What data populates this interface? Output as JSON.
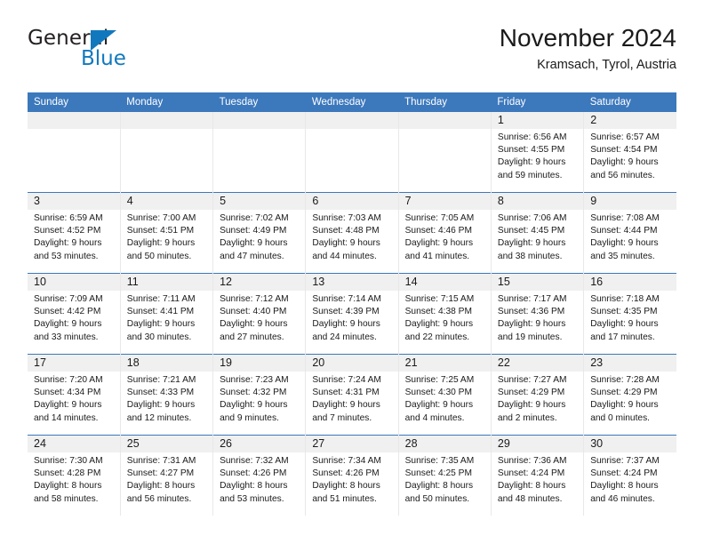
{
  "brand": {
    "name_part1": "General",
    "name_part2": "Blue",
    "triangle_color": "#1278be"
  },
  "header": {
    "title": "November 2024",
    "location": "Kramsach, Tyrol, Austria"
  },
  "theme": {
    "header_blue": "#3c78bc",
    "date_band_gray": "#f0f0f0",
    "text_color": "#1a1a1a"
  },
  "weekday_headers": [
    "Sunday",
    "Monday",
    "Tuesday",
    "Wednesday",
    "Thursday",
    "Friday",
    "Saturday"
  ],
  "weeks": [
    [
      {
        "day": "",
        "details": ""
      },
      {
        "day": "",
        "details": ""
      },
      {
        "day": "",
        "details": ""
      },
      {
        "day": "",
        "details": ""
      },
      {
        "day": "",
        "details": ""
      },
      {
        "day": "1",
        "details": "Sunrise: 6:56 AM\nSunset: 4:55 PM\nDaylight: 9 hours\nand 59 minutes."
      },
      {
        "day": "2",
        "details": "Sunrise: 6:57 AM\nSunset: 4:54 PM\nDaylight: 9 hours\nand 56 minutes."
      }
    ],
    [
      {
        "day": "3",
        "details": "Sunrise: 6:59 AM\nSunset: 4:52 PM\nDaylight: 9 hours\nand 53 minutes."
      },
      {
        "day": "4",
        "details": "Sunrise: 7:00 AM\nSunset: 4:51 PM\nDaylight: 9 hours\nand 50 minutes."
      },
      {
        "day": "5",
        "details": "Sunrise: 7:02 AM\nSunset: 4:49 PM\nDaylight: 9 hours\nand 47 minutes."
      },
      {
        "day": "6",
        "details": "Sunrise: 7:03 AM\nSunset: 4:48 PM\nDaylight: 9 hours\nand 44 minutes."
      },
      {
        "day": "7",
        "details": "Sunrise: 7:05 AM\nSunset: 4:46 PM\nDaylight: 9 hours\nand 41 minutes."
      },
      {
        "day": "8",
        "details": "Sunrise: 7:06 AM\nSunset: 4:45 PM\nDaylight: 9 hours\nand 38 minutes."
      },
      {
        "day": "9",
        "details": "Sunrise: 7:08 AM\nSunset: 4:44 PM\nDaylight: 9 hours\nand 35 minutes."
      }
    ],
    [
      {
        "day": "10",
        "details": "Sunrise: 7:09 AM\nSunset: 4:42 PM\nDaylight: 9 hours\nand 33 minutes."
      },
      {
        "day": "11",
        "details": "Sunrise: 7:11 AM\nSunset: 4:41 PM\nDaylight: 9 hours\nand 30 minutes."
      },
      {
        "day": "12",
        "details": "Sunrise: 7:12 AM\nSunset: 4:40 PM\nDaylight: 9 hours\nand 27 minutes."
      },
      {
        "day": "13",
        "details": "Sunrise: 7:14 AM\nSunset: 4:39 PM\nDaylight: 9 hours\nand 24 minutes."
      },
      {
        "day": "14",
        "details": "Sunrise: 7:15 AM\nSunset: 4:38 PM\nDaylight: 9 hours\nand 22 minutes."
      },
      {
        "day": "15",
        "details": "Sunrise: 7:17 AM\nSunset: 4:36 PM\nDaylight: 9 hours\nand 19 minutes."
      },
      {
        "day": "16",
        "details": "Sunrise: 7:18 AM\nSunset: 4:35 PM\nDaylight: 9 hours\nand 17 minutes."
      }
    ],
    [
      {
        "day": "17",
        "details": "Sunrise: 7:20 AM\nSunset: 4:34 PM\nDaylight: 9 hours\nand 14 minutes."
      },
      {
        "day": "18",
        "details": "Sunrise: 7:21 AM\nSunset: 4:33 PM\nDaylight: 9 hours\nand 12 minutes."
      },
      {
        "day": "19",
        "details": "Sunrise: 7:23 AM\nSunset: 4:32 PM\nDaylight: 9 hours\nand 9 minutes."
      },
      {
        "day": "20",
        "details": "Sunrise: 7:24 AM\nSunset: 4:31 PM\nDaylight: 9 hours\nand 7 minutes."
      },
      {
        "day": "21",
        "details": "Sunrise: 7:25 AM\nSunset: 4:30 PM\nDaylight: 9 hours\nand 4 minutes."
      },
      {
        "day": "22",
        "details": "Sunrise: 7:27 AM\nSunset: 4:29 PM\nDaylight: 9 hours\nand 2 minutes."
      },
      {
        "day": "23",
        "details": "Sunrise: 7:28 AM\nSunset: 4:29 PM\nDaylight: 9 hours\nand 0 minutes."
      }
    ],
    [
      {
        "day": "24",
        "details": "Sunrise: 7:30 AM\nSunset: 4:28 PM\nDaylight: 8 hours\nand 58 minutes."
      },
      {
        "day": "25",
        "details": "Sunrise: 7:31 AM\nSunset: 4:27 PM\nDaylight: 8 hours\nand 56 minutes."
      },
      {
        "day": "26",
        "details": "Sunrise: 7:32 AM\nSunset: 4:26 PM\nDaylight: 8 hours\nand 53 minutes."
      },
      {
        "day": "27",
        "details": "Sunrise: 7:34 AM\nSunset: 4:26 PM\nDaylight: 8 hours\nand 51 minutes."
      },
      {
        "day": "28",
        "details": "Sunrise: 7:35 AM\nSunset: 4:25 PM\nDaylight: 8 hours\nand 50 minutes."
      },
      {
        "day": "29",
        "details": "Sunrise: 7:36 AM\nSunset: 4:24 PM\nDaylight: 8 hours\nand 48 minutes."
      },
      {
        "day": "30",
        "details": "Sunrise: 7:37 AM\nSunset: 4:24 PM\nDaylight: 8 hours\nand 46 minutes."
      }
    ]
  ]
}
